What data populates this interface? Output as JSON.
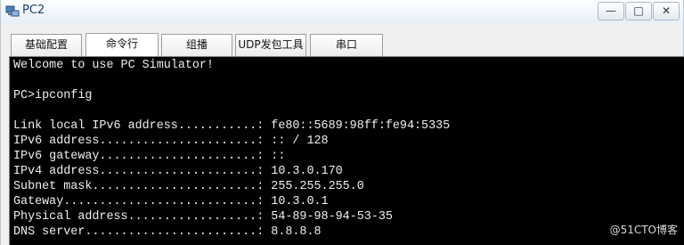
{
  "window": {
    "title": "PC2",
    "controls": {
      "minimize": "—",
      "maximize": "□",
      "close": "✕"
    }
  },
  "tabs": [
    {
      "label": "基础配置",
      "active": false
    },
    {
      "label": "命令行",
      "active": true
    },
    {
      "label": "组播",
      "active": false
    },
    {
      "label": "UDP发包工具",
      "active": false
    },
    {
      "label": "串口",
      "active": false
    }
  ],
  "terminal": {
    "lines": [
      "Welcome to use PC Simulator!",
      "",
      "PC>ipconfig",
      "",
      "Link local IPv6 address...........: fe80::5689:98ff:fe94:5335",
      "IPv6 address......................: :: / 128",
      "IPv6 gateway......................: ::",
      "IPv4 address......................: 10.3.0.170",
      "Subnet mask.......................: 255.255.255.0",
      "Gateway...........................: 10.3.0.1",
      "Physical address..................: 54-89-98-94-53-35",
      "DNS server........................: 8.8.8.8"
    ]
  },
  "watermark": "@51CTO博客",
  "colors": {
    "terminal_bg": "#000000",
    "terminal_fg": "#f0f0f0",
    "title_text": "#1a3d6e"
  },
  "icons": {
    "app": "pc-simulator-icon"
  }
}
